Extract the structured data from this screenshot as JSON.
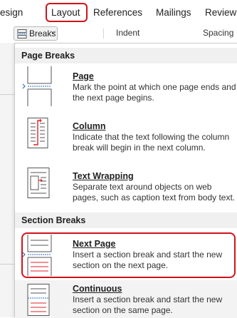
{
  "ribbon": {
    "tabs": [
      "esign",
      "Layout",
      "References",
      "Mailings",
      "Review"
    ],
    "active_tab": "Layout"
  },
  "toolbar": {
    "breaks_label": "Breaks",
    "indent_label": "Indent",
    "spacing_label": "Spacing"
  },
  "menu": {
    "page_breaks_header": "Page Breaks",
    "section_breaks_header": "Section Breaks",
    "items": [
      {
        "title": "Page",
        "desc": "Mark the point at which one page ends and the next page begins.",
        "icon": "page-break-icon"
      },
      {
        "title": "Column",
        "desc": "Indicate that the text following the column break will begin in the next column.",
        "icon": "column-break-icon"
      },
      {
        "title": "Text Wrapping",
        "desc": "Separate text around objects on web pages, such as caption text from body text.",
        "icon": "text-wrapping-icon"
      },
      {
        "title": "Next Page",
        "desc": "Insert a section break and start the new section on the next page.",
        "icon": "next-page-icon"
      },
      {
        "title": "Continuous",
        "desc": "Insert a section break and start the new section on the same page.",
        "icon": "continuous-icon"
      }
    ]
  },
  "colors": {
    "highlight_red": "#d0121b",
    "icon_red": "#e0212a",
    "icon_blue": "#2b6cc4"
  }
}
